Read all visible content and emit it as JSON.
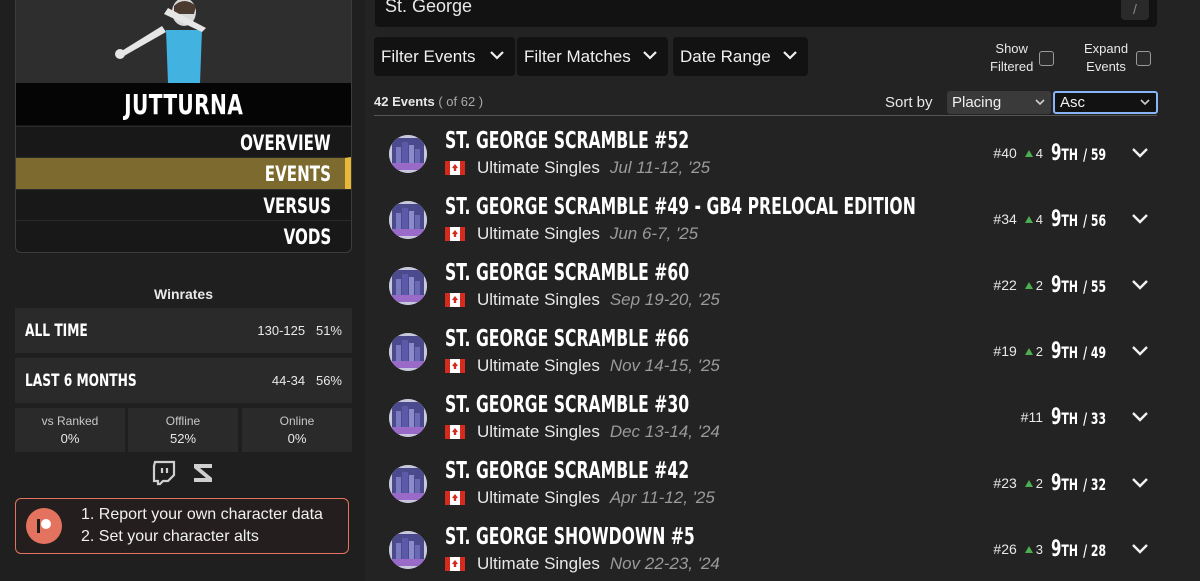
{
  "sidebar": {
    "character_name": "JUTTURNA",
    "nav": [
      {
        "label": "OVERVIEW",
        "active": false
      },
      {
        "label": "EVENTS",
        "active": true
      },
      {
        "label": "VERSUS",
        "active": false
      },
      {
        "label": "VODS",
        "active": false
      }
    ],
    "winrates_title": "Winrates",
    "all_time": {
      "label": "ALL TIME",
      "record": "130-125",
      "pct": "51%"
    },
    "last6": {
      "label": "LAST 6 MONTHS",
      "record": "44-34",
      "pct": "56%"
    },
    "boxes": [
      {
        "label": "vs Ranked",
        "value": "0%"
      },
      {
        "label": "Offline",
        "value": "52%"
      },
      {
        "label": "Online",
        "value": "0%"
      }
    ],
    "patreon_lines": [
      "1. Report your own character data",
      "2. Set your character alts"
    ]
  },
  "search": {
    "value": "St. George",
    "shortcut": "/"
  },
  "filters": {
    "events": "Filter Events",
    "matches": "Filter Matches",
    "date": "Date Range",
    "show_filtered": [
      "Show",
      "Filtered"
    ],
    "expand_events": [
      "Expand",
      "Events"
    ]
  },
  "summary": {
    "count": "42 Events",
    "total": "( of 62 )"
  },
  "sort": {
    "label": "Sort by",
    "field": "Placing",
    "order": "Asc"
  },
  "accent_colors": {
    "active_nav": "#7d6a2e",
    "active_bar": "#e8b838",
    "patreon": "#e3735e",
    "up_arrow": "#4caf50"
  },
  "events": [
    {
      "title": "ST. GEORGE SCRAMBLE #52",
      "game": "Ultimate Singles",
      "date": "Jul 11-12, '25",
      "seed": "#40",
      "up": "4",
      "place": "9",
      "place_suffix": "TH",
      "entrants": "/ 59"
    },
    {
      "title": "ST. GEORGE SCRAMBLE #49 - GB4 PRELOCAL EDITION",
      "game": "Ultimate Singles",
      "date": "Jun 6-7, '25",
      "seed": "#34",
      "up": "4",
      "place": "9",
      "place_suffix": "TH",
      "entrants": "/ 56"
    },
    {
      "title": "ST. GEORGE SCRAMBLE #60",
      "game": "Ultimate Singles",
      "date": "Sep 19-20, '25",
      "seed": "#22",
      "up": "2",
      "place": "9",
      "place_suffix": "TH",
      "entrants": "/ 55"
    },
    {
      "title": "ST. GEORGE SCRAMBLE #66",
      "game": "Ultimate Singles",
      "date": "Nov 14-15, '25",
      "seed": "#19",
      "up": "2",
      "place": "9",
      "place_suffix": "TH",
      "entrants": "/ 49"
    },
    {
      "title": "ST. GEORGE SCRAMBLE #30",
      "game": "Ultimate Singles",
      "date": "Dec 13-14, '24",
      "seed": "#11",
      "up": "",
      "place": "9",
      "place_suffix": "TH",
      "entrants": "/ 33"
    },
    {
      "title": "ST. GEORGE SCRAMBLE #42",
      "game": "Ultimate Singles",
      "date": "Apr 11-12, '25",
      "seed": "#23",
      "up": "2",
      "place": "9",
      "place_suffix": "TH",
      "entrants": "/ 32"
    },
    {
      "title": "ST. GEORGE SHOWDOWN #5",
      "game": "Ultimate Singles",
      "date": "Nov 22-23, '24",
      "seed": "#26",
      "up": "3",
      "place": "9",
      "place_suffix": "TH",
      "entrants": "/ 28"
    }
  ]
}
